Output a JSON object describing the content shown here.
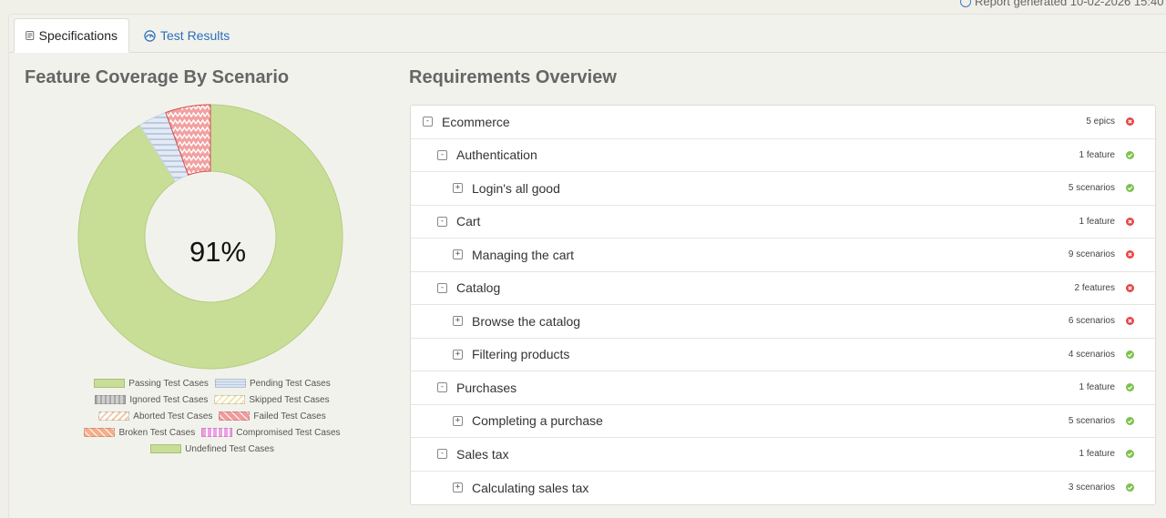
{
  "header": {
    "report_generated": "Report generated 10-02-2026 15:40"
  },
  "tabs": [
    {
      "label": "Specifications",
      "icon": "document-icon",
      "active": true
    },
    {
      "label": "Test Results",
      "icon": "dashboard-icon",
      "active": false
    }
  ],
  "coverage": {
    "title": "Feature Coverage By Scenario",
    "percent_label": "91%",
    "chart_data": {
      "type": "pie",
      "title": "",
      "slices": [
        {
          "name": "Passing Test Cases",
          "value": 91,
          "color": "#c8de96"
        },
        {
          "name": "Pending Test Cases",
          "value": 3.5,
          "color": "#dde6f2"
        },
        {
          "name": "Failed Test Cases",
          "value": 5.5,
          "color": "#f29b9b"
        }
      ]
    },
    "legend": [
      {
        "label": "Passing Test Cases",
        "color": "#c8de96",
        "pattern": "solid"
      },
      {
        "label": "Pending Test Cases",
        "color": "#d8e4f2",
        "pattern": "stripes"
      },
      {
        "label": "Ignored Test Cases",
        "color": "#cfcfcf",
        "pattern": "vbars"
      },
      {
        "label": "Skipped Test Cases",
        "color": "#f2e6b0",
        "pattern": "diag"
      },
      {
        "label": "Aborted Test Cases",
        "color": "#f5c9a8",
        "pattern": "diag"
      },
      {
        "label": "Failed Test Cases",
        "color": "#f29b9b",
        "pattern": "zigzag"
      },
      {
        "label": "Broken Test Cases",
        "color": "#f5ad8a",
        "pattern": "zigzag"
      },
      {
        "label": "Compromised Test Cases",
        "color": "#ef9fe6",
        "pattern": "dots"
      },
      {
        "label": "Undefined Test Cases",
        "color": "#c8de96",
        "pattern": "solid"
      }
    ]
  },
  "requirements": {
    "title": "Requirements Overview",
    "rows": [
      {
        "level": 0,
        "expand": "-",
        "label": "Ecommerce",
        "count": "5 epics",
        "status": "fail"
      },
      {
        "level": 1,
        "expand": "-",
        "label": "Authentication",
        "count": "1 feature",
        "status": "ok"
      },
      {
        "level": 2,
        "expand": "+",
        "label": "Login's all good",
        "count": "5 scenarios",
        "status": "ok"
      },
      {
        "level": 1,
        "expand": "-",
        "label": "Cart",
        "count": "1 feature",
        "status": "fail"
      },
      {
        "level": 2,
        "expand": "+",
        "label": "Managing the cart",
        "count": "9 scenarios",
        "status": "fail"
      },
      {
        "level": 1,
        "expand": "-",
        "label": "Catalog",
        "count": "2 features",
        "status": "fail"
      },
      {
        "level": 2,
        "expand": "+",
        "label": "Browse the catalog",
        "count": "6 scenarios",
        "status": "fail"
      },
      {
        "level": 2,
        "expand": "+",
        "label": "Filtering products",
        "count": "4 scenarios",
        "status": "ok"
      },
      {
        "level": 1,
        "expand": "-",
        "label": "Purchases",
        "count": "1 feature",
        "status": "ok"
      },
      {
        "level": 2,
        "expand": "+",
        "label": "Completing a purchase",
        "count": "5 scenarios",
        "status": "ok"
      },
      {
        "level": 1,
        "expand": "-",
        "label": "Sales tax",
        "count": "1 feature",
        "status": "ok"
      },
      {
        "level": 2,
        "expand": "+",
        "label": "Calculating sales tax",
        "count": "3 scenarios",
        "status": "ok"
      }
    ]
  }
}
